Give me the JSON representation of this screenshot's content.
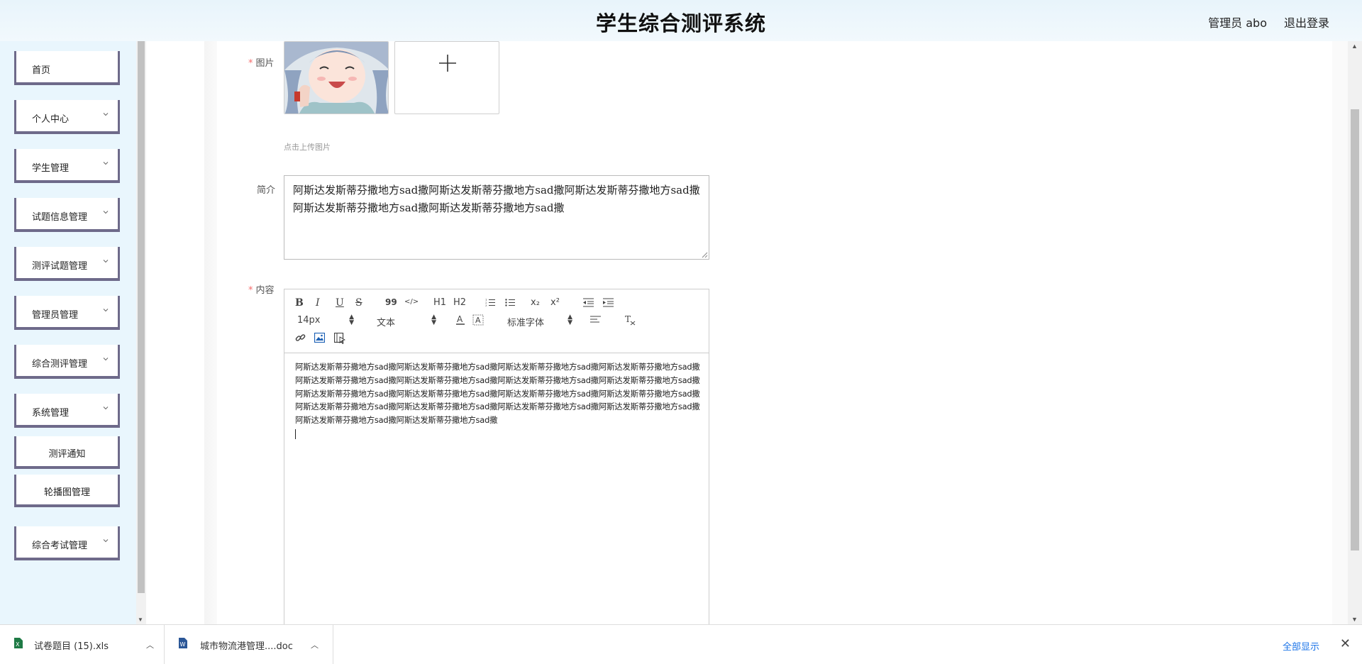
{
  "header": {
    "title": "学生综合测评系统",
    "user_label": "管理员 abo",
    "logout_label": "退出登录"
  },
  "sidebar": {
    "items": [
      {
        "label": "首页",
        "expandable": false
      },
      {
        "label": "个人中心",
        "expandable": true
      },
      {
        "label": "学生管理",
        "expandable": true
      },
      {
        "label": "试题信息管理",
        "expandable": true
      },
      {
        "label": "测评试题管理",
        "expandable": true
      },
      {
        "label": "管理员管理",
        "expandable": true
      },
      {
        "label": "综合测评管理",
        "expandable": true
      },
      {
        "label": "系统管理",
        "expandable": true
      },
      {
        "label": "测评通知",
        "expandable": false
      },
      {
        "label": "轮播图管理",
        "expandable": false
      },
      {
        "label": "综合考试管理",
        "expandable": true
      }
    ]
  },
  "form": {
    "image_label": "图片",
    "upload_hint": "点击上传图片",
    "intro_label": "简介",
    "intro_value": "阿斯达发斯蒂芬撒地方sad撒阿斯达发斯蒂芬撒地方sad撒阿斯达发斯蒂芬撒地方sad撒阿斯达发斯蒂芬撒地方sad撒阿斯达发斯蒂芬撒地方sad撒",
    "content_label": "内容",
    "content_value": "阿斯达发斯蒂芬撒地方sad撒阿斯达发斯蒂芬撒地方sad撒阿斯达发斯蒂芬撒地方sad撒阿斯达发斯蒂芬撒地方sad撒阿斯达发斯蒂芬撒地方sad撒阿斯达发斯蒂芬撒地方sad撒阿斯达发斯蒂芬撒地方sad撒阿斯达发斯蒂芬撒地方sad撒阿斯达发斯蒂芬撒地方sad撒阿斯达发斯蒂芬撒地方sad撒阿斯达发斯蒂芬撒地方sad撒阿斯达发斯蒂芬撒地方sad撒阿斯达发斯蒂芬撒地方sad撒阿斯达发斯蒂芬撒地方sad撒阿斯达发斯蒂芬撒地方sad撒阿斯达发斯蒂芬撒地方sad撒阿斯达发斯蒂芬撒地方sad撒阿斯达发斯蒂芬撒地方sad撒"
  },
  "editor_toolbar": {
    "bold": "B",
    "italic": "I",
    "underline": "U",
    "strike": "S",
    "blockquote": "99",
    "code": "</>",
    "h1": "H1",
    "h2": "H2",
    "subscript": "x₂",
    "superscript": "x²",
    "size_value": "14px",
    "header_value": "文本",
    "font_value": "标准字体"
  },
  "downloads": {
    "items": [
      {
        "name": "试卷题目 (15).xls",
        "icon": "excel-icon"
      },
      {
        "name": "城市物流港管理....doc",
        "icon": "word-icon"
      }
    ],
    "show_all": "全部显示"
  },
  "colors": {
    "header_bg": "#e8f4fb",
    "sidebar_bg": "#e9f6fd",
    "menu_border": "#6e6a8a",
    "required": "#f56c6c",
    "link": "#1a73e8"
  }
}
